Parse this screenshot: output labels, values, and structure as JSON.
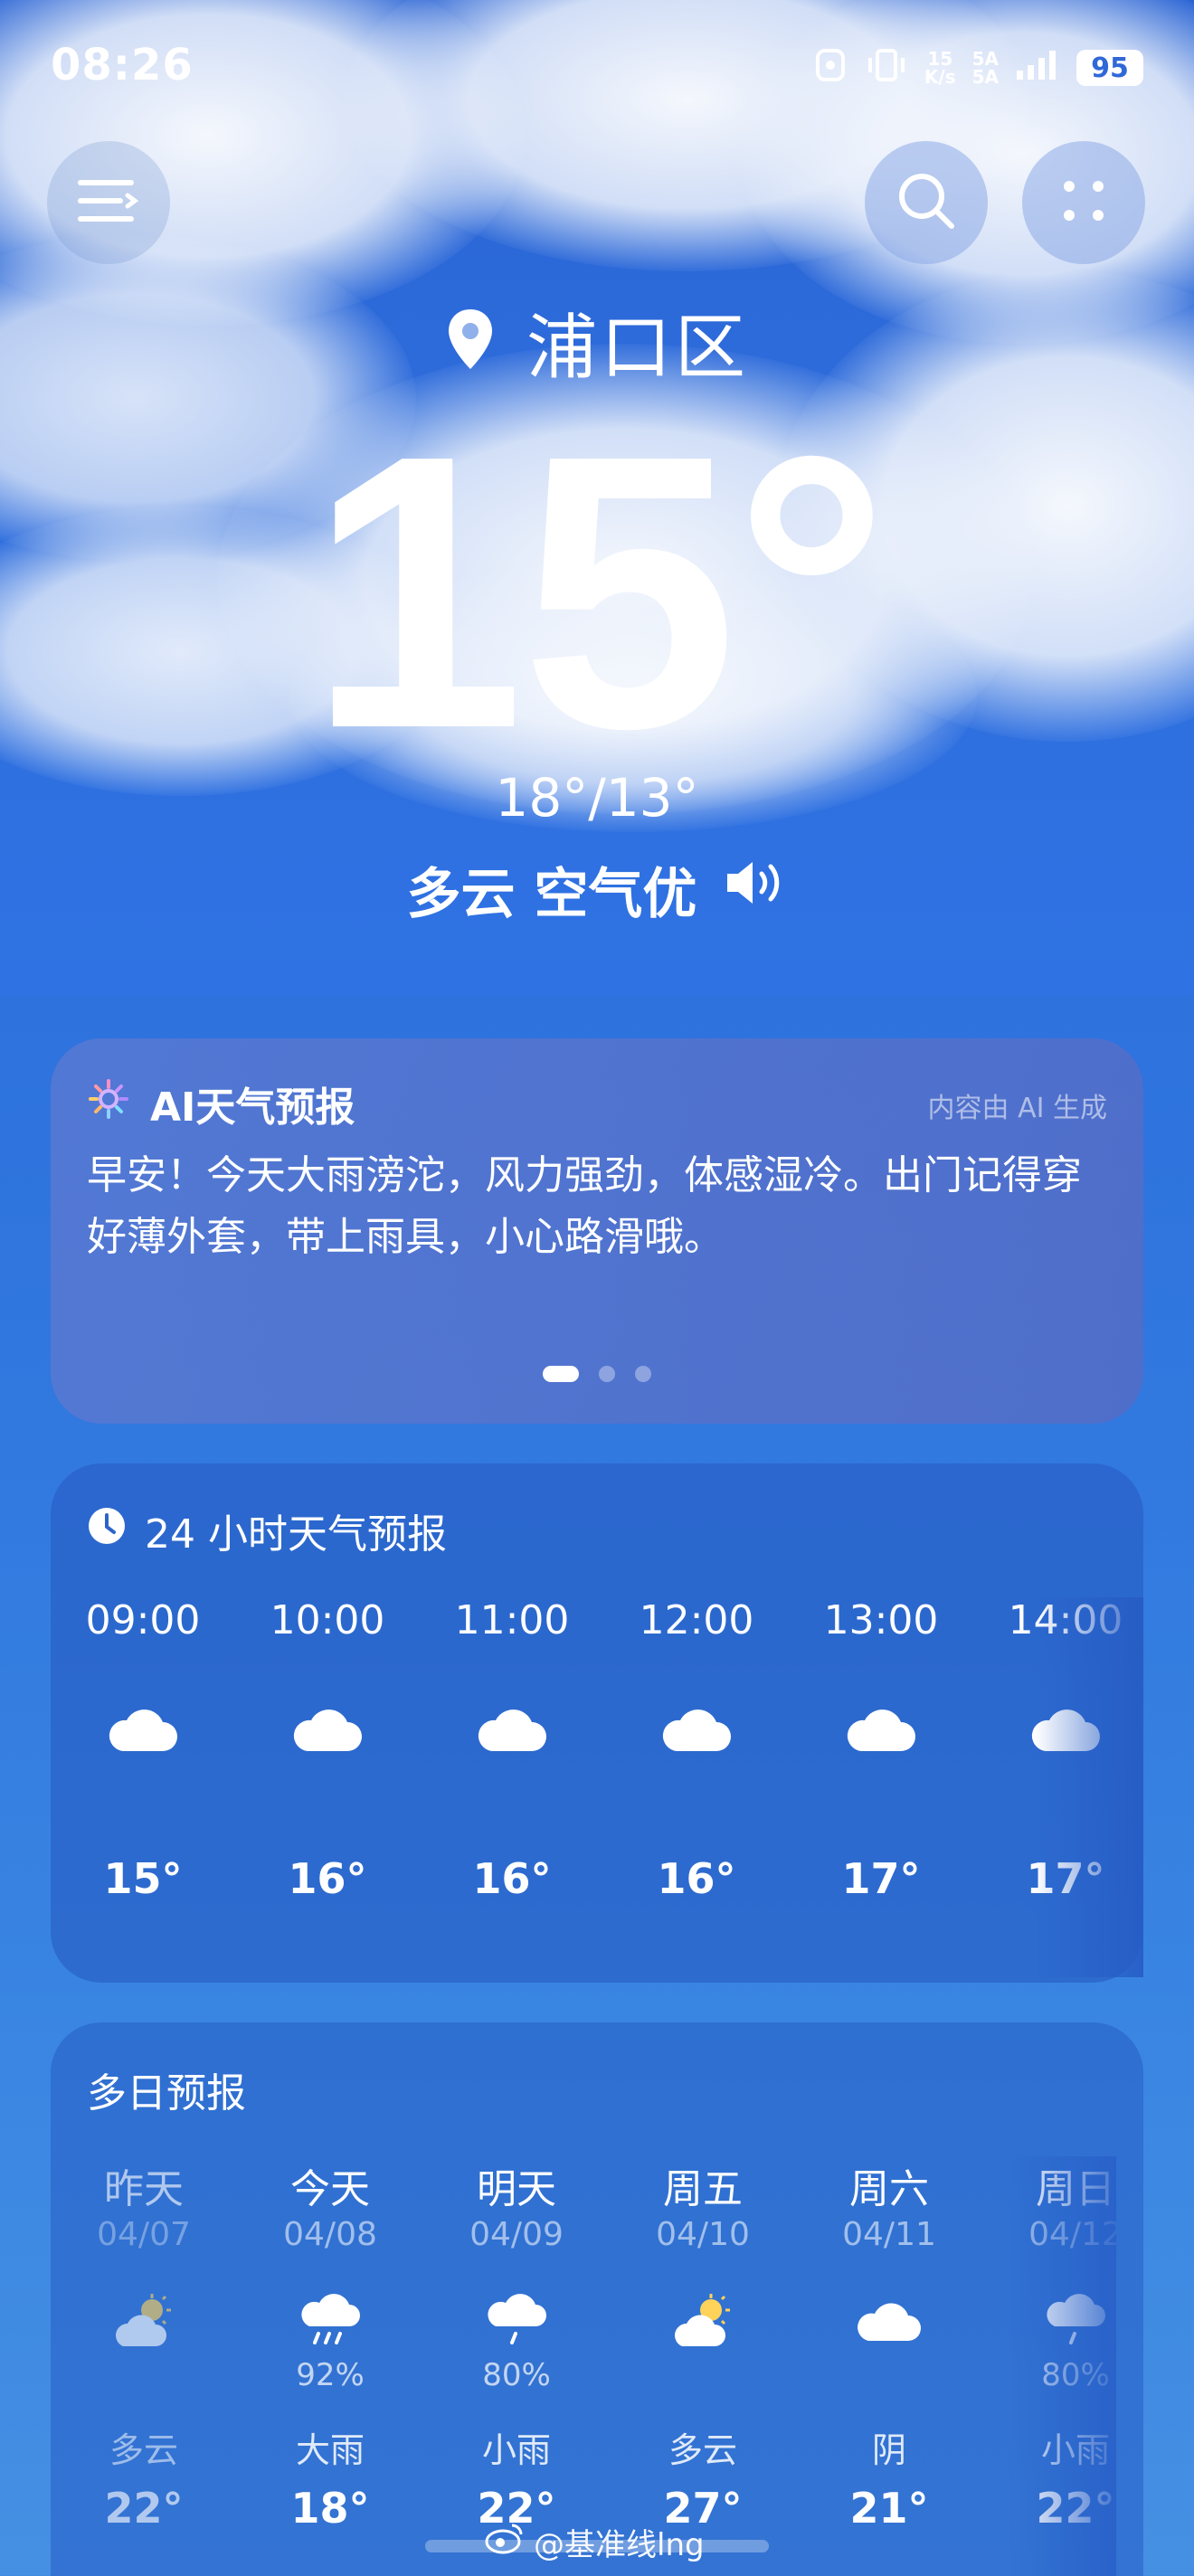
{
  "status": {
    "time": "08:26",
    "net_speed_top": "15",
    "net_speed_unit": "K/s",
    "sig1": "5A",
    "sig2": "5A",
    "battery": "95"
  },
  "header": {
    "location": "浦口区",
    "temperature": "15°",
    "range": "18°/13°",
    "condition": "多云 空气优"
  },
  "ai_card": {
    "title": "AI天气预报",
    "note": "内容由 AI 生成",
    "body": "早安！今天大雨滂沱，风力强劲，体感湿冷。出门记得穿好薄外套，带上雨具，小心路滑哦。",
    "page_count": 3,
    "active_page": 0
  },
  "hourly": {
    "title": "24 小时天气预报",
    "items": [
      {
        "time": "09:00",
        "icon": "cloud-icon",
        "temp": "15°"
      },
      {
        "time": "10:00",
        "icon": "cloud-icon",
        "temp": "16°"
      },
      {
        "time": "11:00",
        "icon": "cloud-icon",
        "temp": "16°"
      },
      {
        "time": "12:00",
        "icon": "cloud-icon",
        "temp": "16°"
      },
      {
        "time": "13:00",
        "icon": "cloud-icon",
        "temp": "17°"
      },
      {
        "time": "14:00",
        "icon": "cloud-icon",
        "temp": "17°"
      }
    ]
  },
  "daily": {
    "title": "多日预报",
    "items": [
      {
        "name": "昨天",
        "date": "04/07",
        "icon": "partly-cloudy-icon",
        "pct": "",
        "cond": "多云",
        "hi": "22°",
        "past": true
      },
      {
        "name": "今天",
        "date": "04/08",
        "icon": "heavy-rain-icon",
        "pct": "92%",
        "cond": "大雨",
        "hi": "18°",
        "past": false
      },
      {
        "name": "明天",
        "date": "04/09",
        "icon": "light-rain-icon",
        "pct": "80%",
        "cond": "小雨",
        "hi": "22°",
        "past": false
      },
      {
        "name": "周五",
        "date": "04/10",
        "icon": "partly-cloudy-icon",
        "pct": "",
        "cond": "多云",
        "hi": "27°",
        "past": false
      },
      {
        "name": "周六",
        "date": "04/11",
        "icon": "overcast-icon",
        "pct": "",
        "cond": "阴",
        "hi": "21°",
        "past": false
      },
      {
        "name": "周日",
        "date": "04/12",
        "icon": "light-rain-icon",
        "pct": "80%",
        "cond": "小雨",
        "hi": "22°",
        "past": false
      }
    ]
  },
  "watermark": "@基准线lng"
}
